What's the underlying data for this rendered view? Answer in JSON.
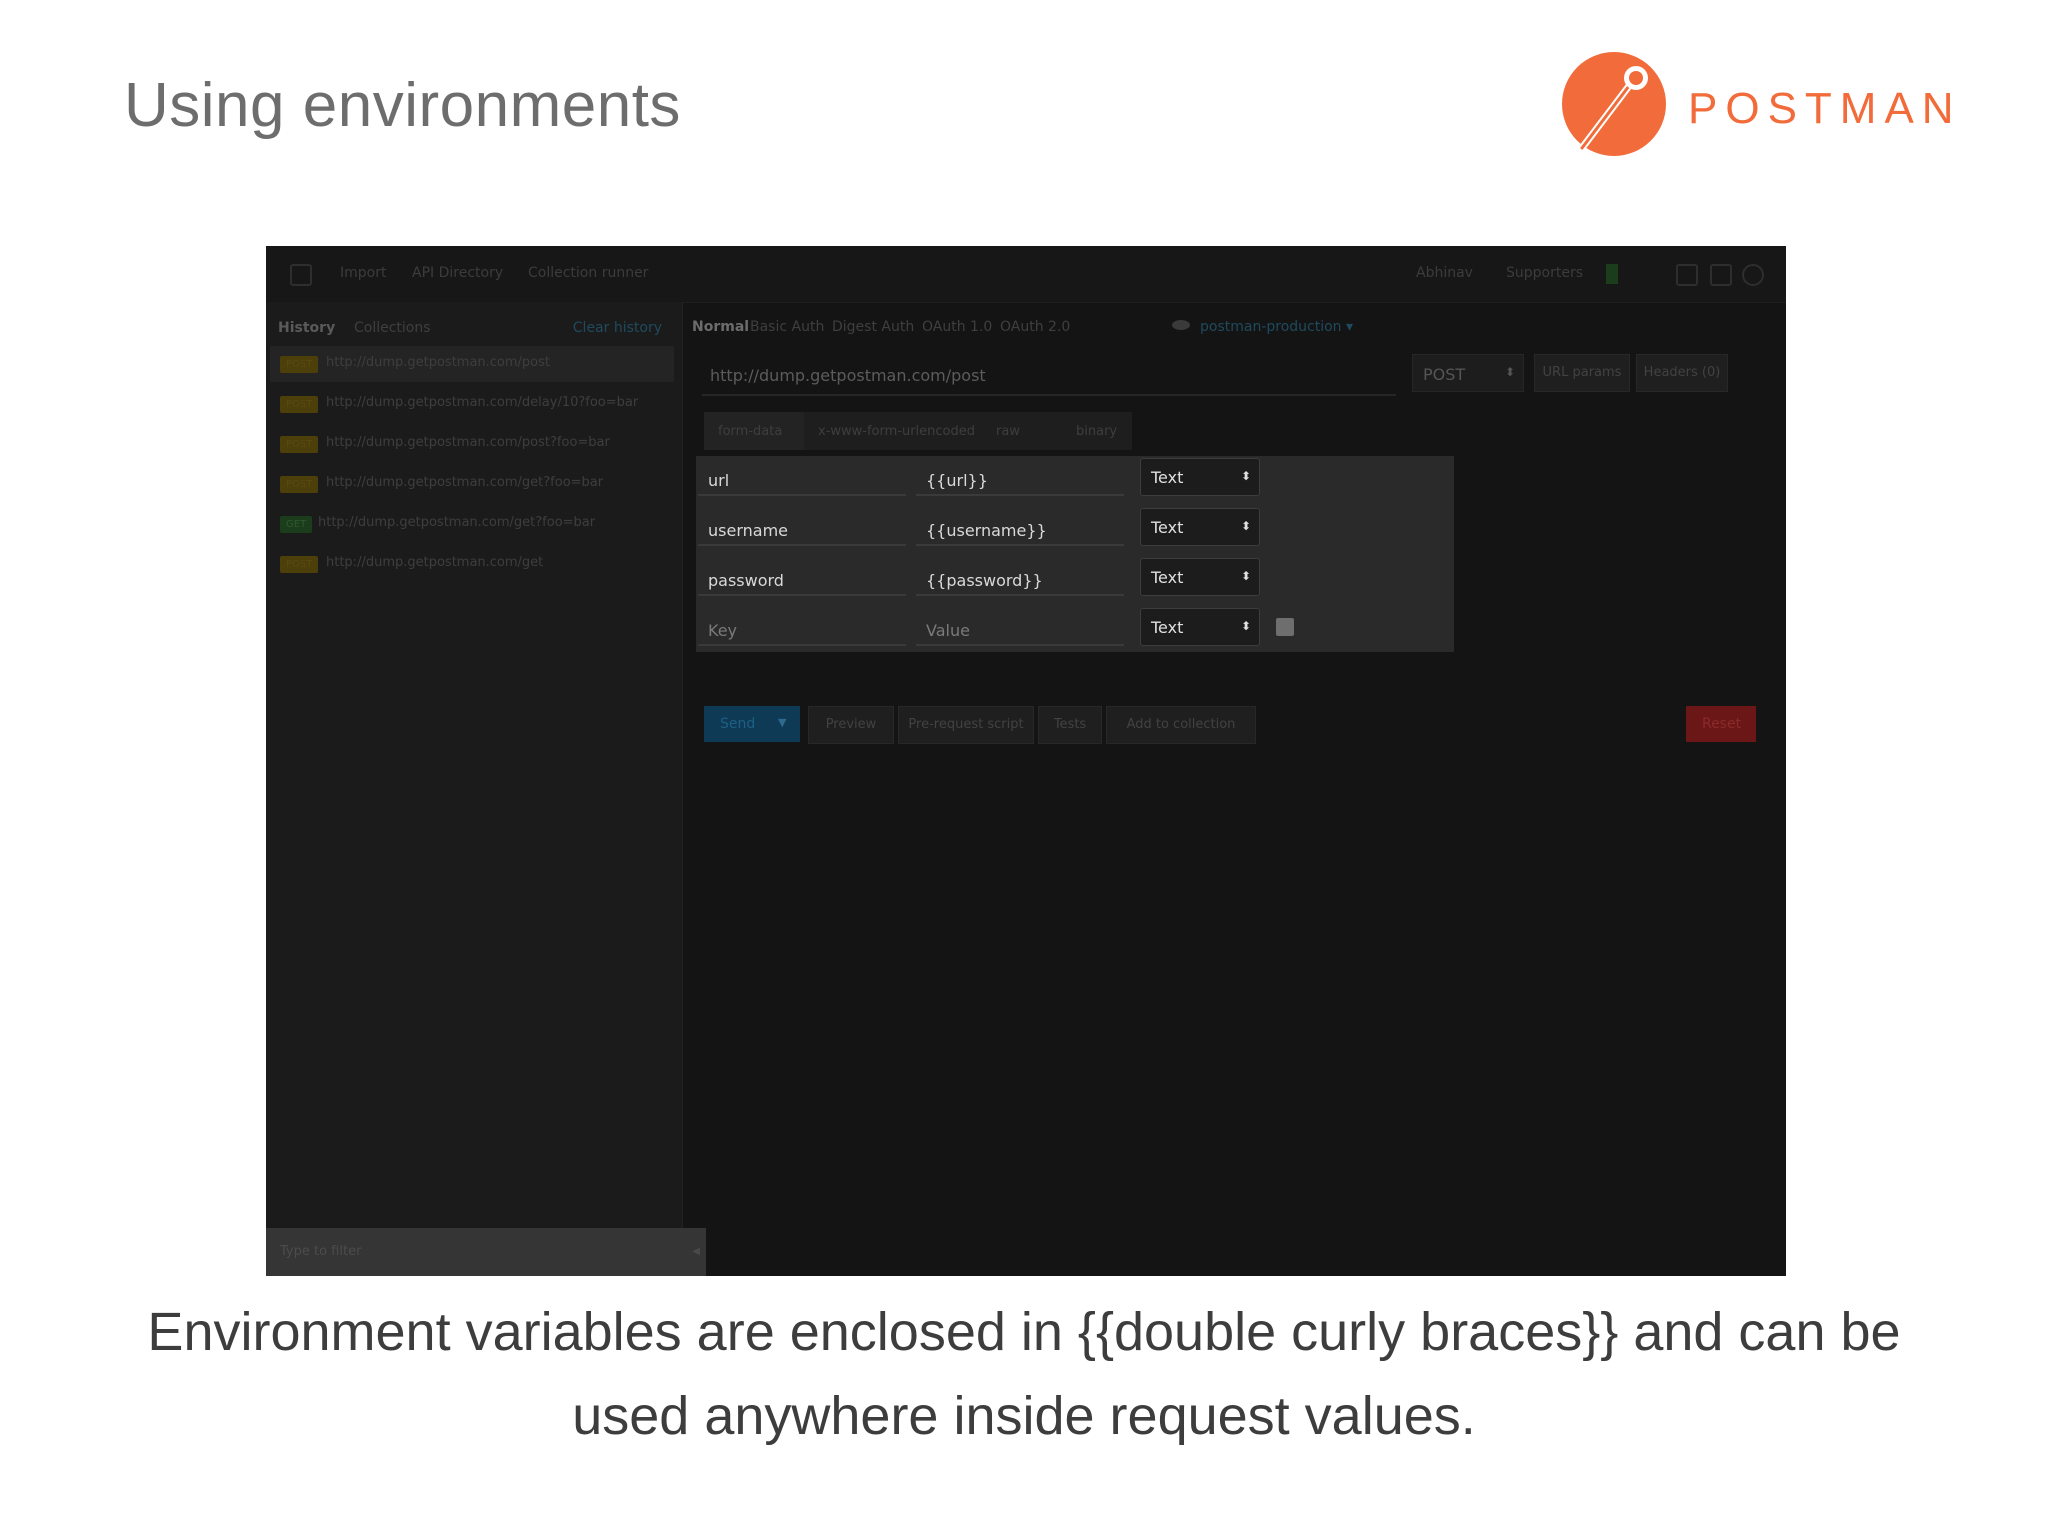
{
  "slide": {
    "title": "Using environments",
    "logo_text": "POSTMAN",
    "caption_line1": "Environment variables are enclosed in {{double curly braces}} and can be",
    "caption_line2": "used anywhere inside request values."
  },
  "colors": {
    "brand": "#f26b3a",
    "app_bg": "#141414",
    "sidebar_bg": "#1b1b1b",
    "accent_link": "#1f4a5e",
    "send": "#0f3a56",
    "reset": "#6b1717",
    "post_badge": "#4d3f09",
    "get_badge": "#1b3d1b"
  },
  "app": {
    "topbar": {
      "items": [
        "Import",
        "API Directory",
        "Collection runner"
      ],
      "right_items": [
        "Abhinav",
        "Supporters"
      ]
    },
    "sidebar": {
      "tabs": [
        "History",
        "Collections"
      ],
      "clear_label": "Clear history",
      "history": [
        {
          "method": "POST",
          "url": "http://dump.getpostman.com/post"
        },
        {
          "method": "POST",
          "url": "http://dump.getpostman.com/delay/10?foo=bar"
        },
        {
          "method": "POST",
          "url": "http://dump.getpostman.com/post?foo=bar"
        },
        {
          "method": "POST",
          "url": "http://dump.getpostman.com/get?foo=bar"
        },
        {
          "method": "GET",
          "url": "http://dump.getpostman.com/get?foo=bar"
        },
        {
          "method": "POST",
          "url": "http://dump.getpostman.com/get"
        }
      ],
      "filter_placeholder": "Type to filter"
    },
    "main": {
      "auth_tabs": [
        "Normal",
        "Basic Auth",
        "Digest Auth",
        "OAuth 1.0",
        "OAuth 2.0"
      ],
      "environment": "postman-production",
      "url": "http://dump.getpostman.com/post",
      "method": "POST",
      "url_params_label": "URL params",
      "headers_label": "Headers (0)",
      "body_tabs": [
        "form-data",
        "x-www-form-urlencoded",
        "raw",
        "binary"
      ],
      "params": [
        {
          "key": "url",
          "value": "{{url}}",
          "type": "Text"
        },
        {
          "key": "username",
          "value": "{{username}}",
          "type": "Text"
        },
        {
          "key": "password",
          "value": "{{password}}",
          "type": "Text"
        }
      ],
      "new_param": {
        "key_placeholder": "Key",
        "value_placeholder": "Value",
        "type": "Text"
      },
      "actions": {
        "send": "Send",
        "preview": "Preview",
        "prerequest": "Pre-request script",
        "tests": "Tests",
        "add_to_collection": "Add to collection",
        "reset": "Reset"
      }
    }
  }
}
